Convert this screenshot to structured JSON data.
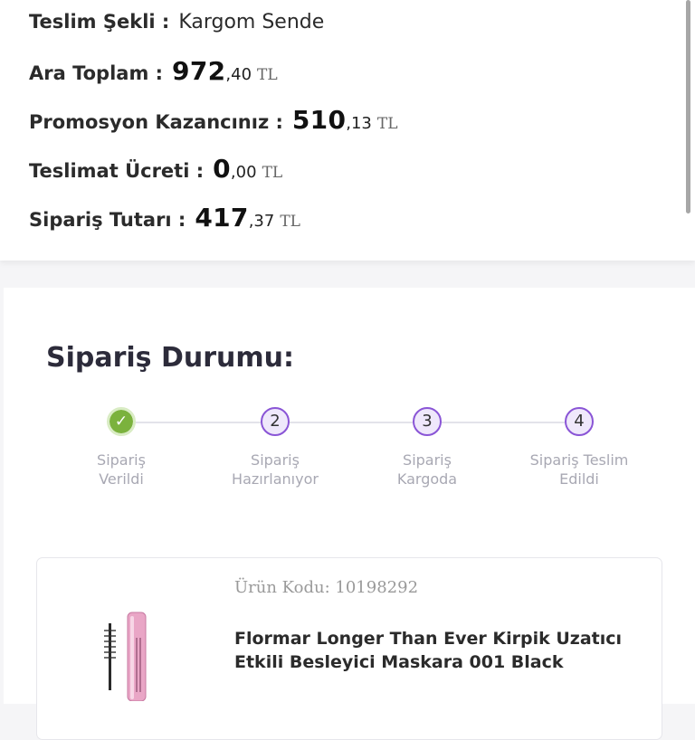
{
  "summary": {
    "delivery": {
      "label": "Teslim Şekli :",
      "value": "Kargom Sende"
    },
    "subtotal": {
      "label": "Ara Toplam :",
      "whole": "972",
      "fraction": ",40",
      "currency": "TL"
    },
    "promo": {
      "label": "Promosyon Kazancınız :",
      "whole": "510",
      "fraction": ",13",
      "currency": "TL"
    },
    "shipping": {
      "label": "Teslimat Ücreti :",
      "whole": "0",
      "fraction": ",00",
      "currency": "TL"
    },
    "total": {
      "label": "Sipariş Tutarı :",
      "whole": "417",
      "fraction": ",37",
      "currency": "TL"
    }
  },
  "status": {
    "title": "Sipariş Durumu:",
    "steps": [
      {
        "line1": "Sipariş",
        "line2": "Verildi",
        "state": "done",
        "icon": "check-icon"
      },
      {
        "number": "2",
        "line1": "Sipariş",
        "line2": "Hazırlanıyor",
        "state": "pending"
      },
      {
        "number": "3",
        "line1": "Sipariş",
        "line2": "Kargoda",
        "state": "pending"
      },
      {
        "number": "4",
        "line1": "Sipariş Teslim",
        "line2": "Edildi",
        "state": "pending"
      }
    ]
  },
  "product": {
    "code_label": "Ürün Kodu:",
    "code_value": "10198292",
    "name": "Flormar Longer Than Ever Kirpik Uzatıcı Etkili Besleyici Maskara 001 Black",
    "image": "mascara-product-image"
  },
  "colors": {
    "accent_purple": "#8a55d6",
    "success_green": "#7bb23d",
    "muted_text": "#a8a8b3"
  }
}
